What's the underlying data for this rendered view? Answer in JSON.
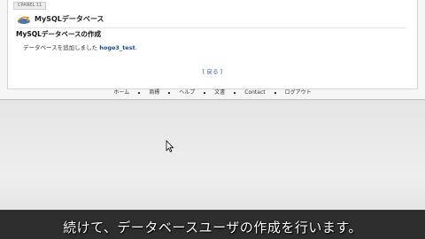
{
  "page": {
    "crumb": "CPANEL 11",
    "app_title": "MySQLデータベース",
    "section_title": "MySQLデータベースの作成",
    "message_prefix": "データベースを追加しました",
    "message_db": "hoge3_test",
    "message_suffix": ".",
    "back_label": "[ 戻る ]"
  },
  "footer": {
    "links": [
      "ホーム",
      "商標",
      "ヘルプ",
      "文書",
      "Contact",
      "ログアウト"
    ]
  },
  "subtitle": "続けて、データベースユーザの作成を行います。",
  "icons": [
    "mysql-app-icon",
    "mouse-cursor-icon"
  ]
}
